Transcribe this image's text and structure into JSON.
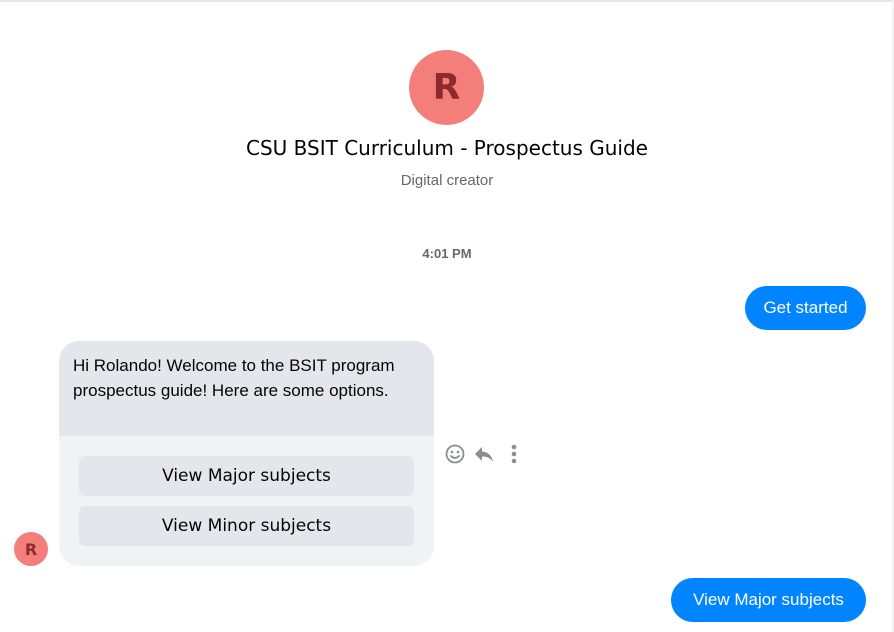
{
  "profile": {
    "avatar_letter": "R",
    "name": "CSU BSIT Curriculum - Prospectus Guide",
    "category": "Digital creator"
  },
  "conversation": {
    "timestamp": "4:01 PM",
    "messages": [
      {
        "from": "user",
        "text": "Get started"
      },
      {
        "from": "page",
        "text": "Hi Rolando! Welcome to the BSIT program prospectus guide! Here are some options."
      },
      {
        "from": "user",
        "text": "View Major subjects"
      }
    ],
    "quick_replies": [
      {
        "label": "View Major subjects"
      },
      {
        "label": "View Minor subjects"
      }
    ]
  },
  "sender_avatar_letter": "R",
  "message_actions": [
    "emoji-react-icon",
    "reply-icon",
    "more-options-icon"
  ],
  "colors": {
    "accent": "#0084ff",
    "avatar_bg": "#f47f7a",
    "avatar_letter": "#8d2a2e",
    "incoming_bubble": "#e4e6eb"
  }
}
